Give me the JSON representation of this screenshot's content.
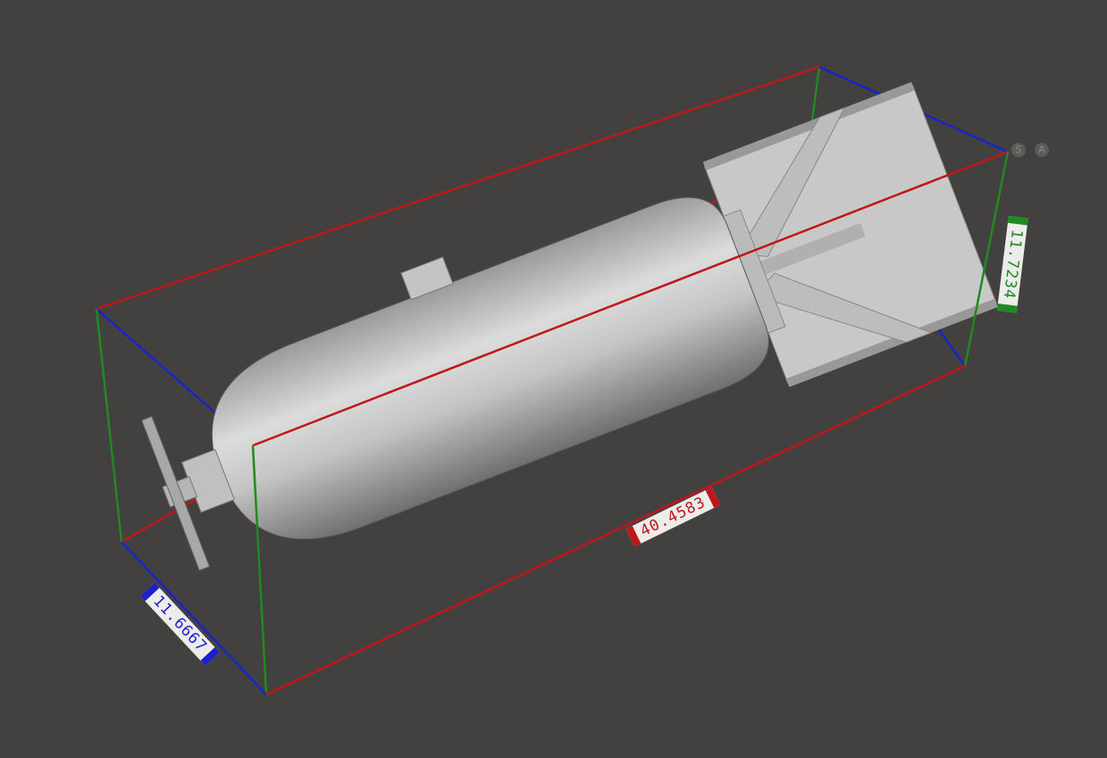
{
  "viewport": {
    "dimensions": {
      "length": "40.4583",
      "height": "11.7234",
      "width": "11.6667"
    },
    "nav_buttons": [
      {
        "label": "S"
      },
      {
        "label": "A"
      }
    ],
    "colors": {
      "background": "#434140",
      "length_axis": "#c0161a",
      "height_axis": "#1f8a1f",
      "width_axis": "#1a22c8",
      "model": "#cfcfcf"
    }
  }
}
